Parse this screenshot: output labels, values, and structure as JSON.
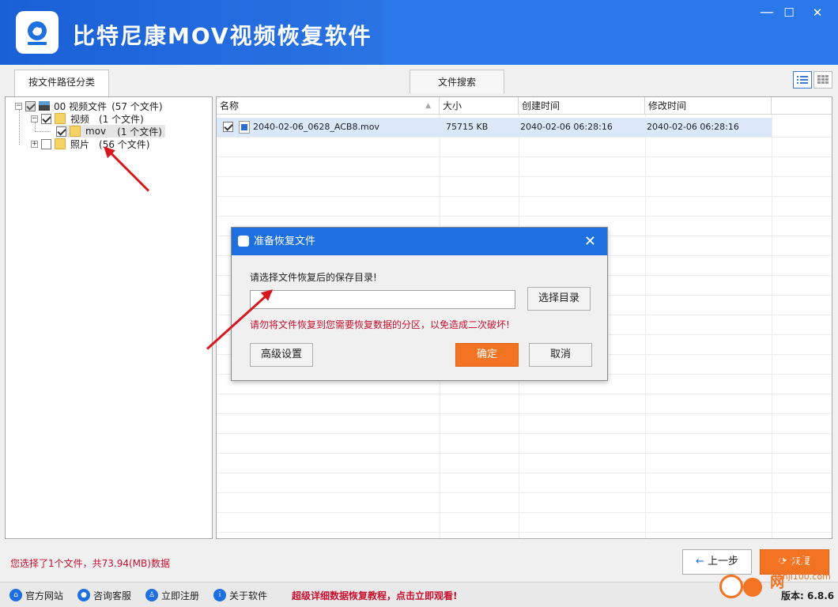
{
  "app": {
    "title": "比特尼康MOV视频恢复软件",
    "window_controls": [
      "—",
      "☐",
      "✕"
    ]
  },
  "tabs": {
    "by_path": "按文件路径分类",
    "search": "文件搜索"
  },
  "tree": {
    "root": {
      "label": "00 视频文件",
      "count": "(57 个文件)"
    },
    "video": {
      "label": "视频",
      "count": "(1 个文件)"
    },
    "mov": {
      "label": "mov",
      "count": "(1 个文件)"
    },
    "photo": {
      "label": "照片",
      "count": "(56 个文件)"
    }
  },
  "file_list": {
    "columns": [
      "名称",
      "大小",
      "创建时间",
      "修改时间"
    ],
    "rows": [
      {
        "name": "2040-02-06_0628_ACB8.mov",
        "size": "75715 KB",
        "created": "2040-02-06  06:28:16",
        "modified": "2040-02-06  06:28:16",
        "checked": true
      }
    ]
  },
  "dialog": {
    "title": "准备恢复文件",
    "prompt": "请选择文件恢复后的保存目录!",
    "path_value": "",
    "choose_dir": "选择目录",
    "warning": "请勿将文件恢复到您需要恢复数据的分区，以免造成二次破坏!",
    "advanced": "高级设置",
    "ok": "确定",
    "cancel": "取消"
  },
  "status": {
    "selection": "您选择了1个文件，共73.94(MB)数据"
  },
  "nav_buttons": {
    "back": "上一步",
    "recover": "恢复"
  },
  "bottom_bar": {
    "links": [
      "官方网站",
      "咨询客服",
      "立即注册",
      "关于软件"
    ],
    "promo": "超级详细数据恢复教程，点击立即观看!",
    "version": "版本: 6.8.6",
    "watermark": "单机100网",
    "watermark_url": "danji100.com"
  },
  "colors": {
    "header_blue": "#1a5fd6",
    "dialog_blue": "#1e6fe0",
    "accent_orange": "#f27321",
    "warning_red": "#c8102e"
  }
}
